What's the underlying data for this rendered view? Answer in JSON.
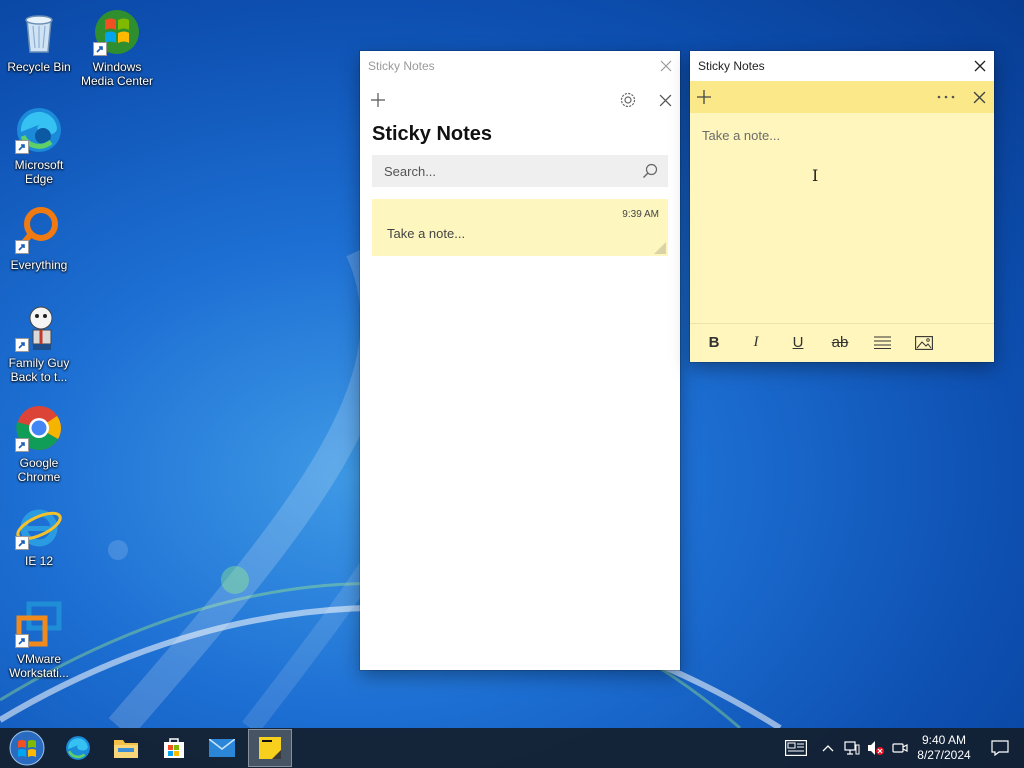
{
  "desktop": {
    "icons": [
      {
        "label": "Recycle Bin",
        "icon": "recycle-bin-icon"
      },
      {
        "label": "Windows Media Center",
        "icon": "windows-media-center-icon"
      },
      {
        "label": "Microsoft Edge",
        "icon": "edge-icon"
      },
      {
        "label": "Everything",
        "icon": "everything-search-icon"
      },
      {
        "label": "Family Guy Back to t...",
        "icon": "family-guy-icon"
      },
      {
        "label": "Google Chrome",
        "icon": "chrome-icon"
      },
      {
        "label": "IE 12",
        "icon": "internet-explorer-icon"
      },
      {
        "label": "VMware Workstati...",
        "icon": "vmware-icon"
      }
    ]
  },
  "list_window": {
    "title": "Sticky Notes",
    "heading": "Sticky Notes",
    "search_placeholder": "Search...",
    "notes": [
      {
        "time": "9:39 AM",
        "preview": "Take a note..."
      }
    ]
  },
  "note_window": {
    "title": "Sticky Notes",
    "placeholder": "Take a note...",
    "format_buttons": [
      "B",
      "I",
      "U",
      "ab"
    ]
  },
  "taskbar": {
    "apps": [
      "start-icon",
      "edge-icon",
      "file-explorer-icon",
      "microsoft-store-icon",
      "mail-icon",
      "sticky-notes-icon"
    ],
    "clock": {
      "time": "9:40 AM",
      "date": "8/27/2024"
    }
  },
  "colors": {
    "note_yellow": "#fff6bd",
    "note_toolbar": "#fbe989",
    "note_card": "#fdf6bf",
    "taskbar": "#141e2d"
  }
}
